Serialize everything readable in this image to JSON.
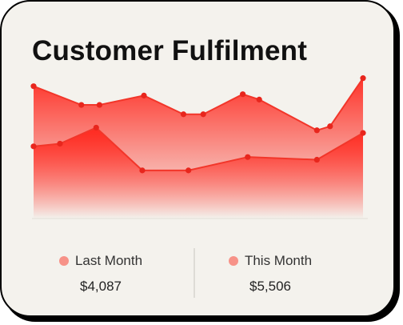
{
  "colors": {
    "background": "#f4f2ed",
    "border": "#000000",
    "line": "#f2362a",
    "point": "#e8261d",
    "fill": "#ff2a20",
    "swatch_last": "#f79288",
    "swatch_this": "#f79288"
  },
  "legend": {
    "last": {
      "name": "Last Month",
      "value": "$4,087"
    },
    "this": {
      "name": "This Month",
      "value": "$5,506"
    }
  },
  "chart_data": {
    "type": "area",
    "title": "Customer Fulfilment",
    "xlabel": "",
    "ylabel": "",
    "ylim": [
      0,
      100
    ],
    "grid": false,
    "series": [
      {
        "name": "This Month",
        "points": [
          [
            0,
            99
          ],
          [
            14.5,
            85
          ],
          [
            20,
            85
          ],
          [
            33.5,
            92
          ],
          [
            45.5,
            78
          ],
          [
            51.5,
            78
          ],
          [
            63.5,
            93
          ],
          [
            68.5,
            89
          ],
          [
            86,
            66
          ],
          [
            90,
            69
          ],
          [
            100,
            105
          ]
        ]
      },
      {
        "name": "Last Month",
        "points": [
          [
            0,
            54
          ],
          [
            8,
            56
          ],
          [
            19,
            68
          ],
          [
            33,
            36
          ],
          [
            47,
            36
          ],
          [
            65,
            46
          ],
          [
            86,
            44
          ],
          [
            100,
            64
          ]
        ]
      }
    ]
  }
}
